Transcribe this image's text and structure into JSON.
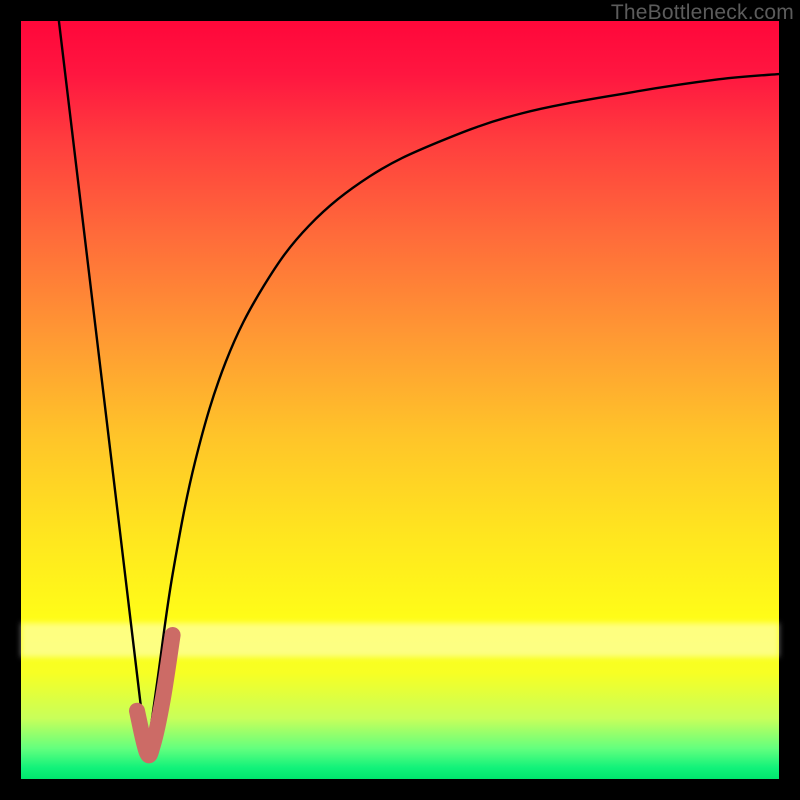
{
  "watermark": "TheBottleneck.com",
  "colors": {
    "frame": "#000000",
    "line": "#000000",
    "highlight": "#cc6b66"
  },
  "chart_data": {
    "type": "line",
    "title": "",
    "xlabel": "",
    "ylabel": "",
    "xlim": [
      0,
      100
    ],
    "ylim": [
      0,
      100
    ],
    "grid": false,
    "series": [
      {
        "name": "left-slope",
        "x": [
          5,
          16.6
        ],
        "y": [
          100,
          3
        ]
      },
      {
        "name": "right-curve",
        "x": [
          16.6,
          18,
          20,
          23,
          27,
          32,
          38,
          46,
          55,
          66,
          80,
          92,
          100
        ],
        "y": [
          3,
          13,
          27,
          42,
          55,
          65,
          73,
          79.5,
          84,
          87.8,
          90.5,
          92.3,
          93
        ]
      }
    ],
    "highlight_segment": {
      "name": "bottom-j",
      "x": [
        15.3,
        16.6,
        17.4,
        18.7,
        20.0
      ],
      "y": [
        9,
        3.5,
        4.5,
        10.5,
        19
      ]
    }
  }
}
